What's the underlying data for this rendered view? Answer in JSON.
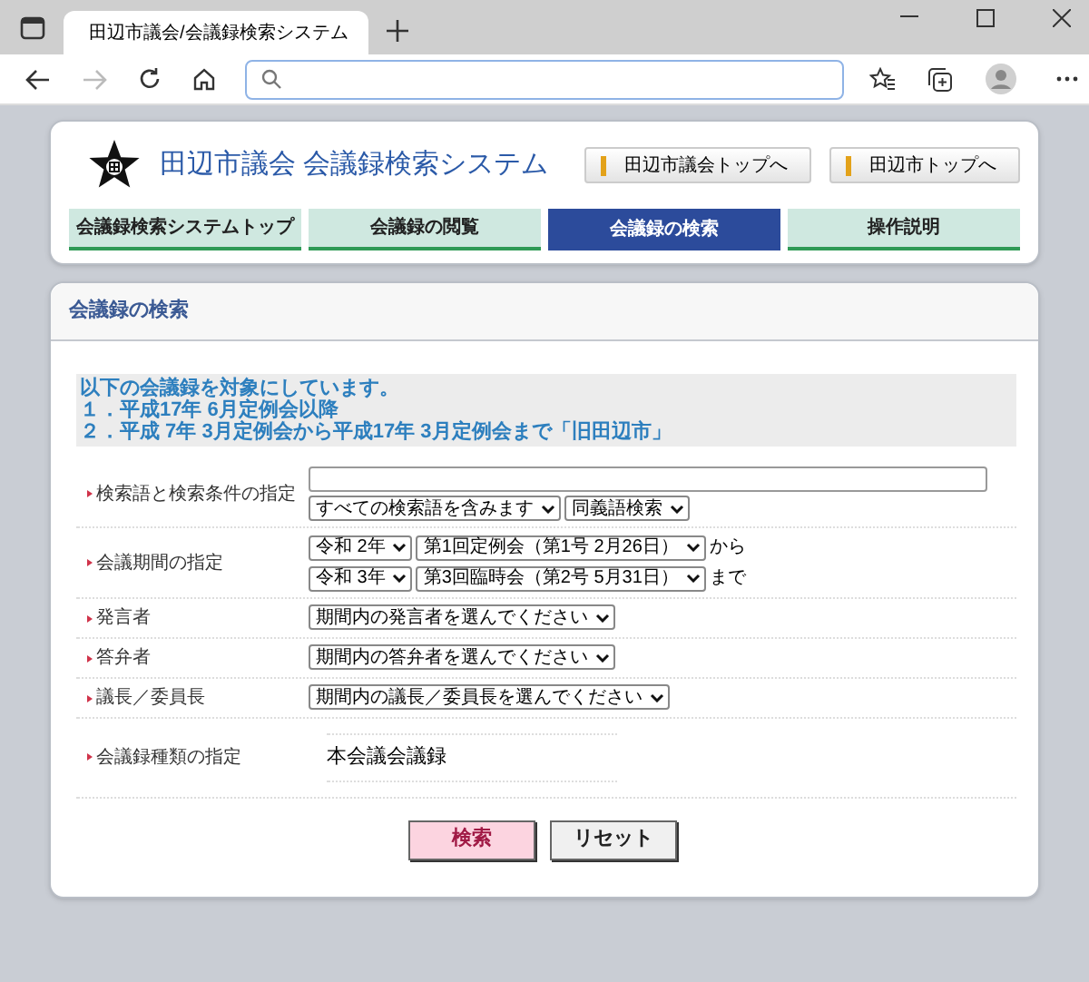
{
  "browser": {
    "tab_title": "田辺市議会/会議録検索システム"
  },
  "header": {
    "title": "田辺市議会 会議録検索システム",
    "links": [
      "田辺市議会トップへ",
      "田辺市トップへ"
    ],
    "nav": [
      {
        "label": "会議録検索システムトップ",
        "selected": false
      },
      {
        "label": "会議録の閲覧",
        "selected": false
      },
      {
        "label": "会議録の検索",
        "selected": true
      },
      {
        "label": "操作説明",
        "selected": false
      }
    ]
  },
  "panel": {
    "title": "会議録の検索",
    "notice": [
      "以下の会議録を対象にしています。",
      "１．平成17年 6月定例会以降",
      "２．平成 7年 3月定例会から平成17年 3月定例会まで「旧田辺市」"
    ],
    "rows": [
      {
        "kind": "keyword",
        "label": "検索語と検索条件の指定",
        "lines": [
          {
            "selects": [
              "すべての検索語を含みます",
              "同義語検索"
            ]
          }
        ]
      },
      {
        "kind": "period",
        "label": "会議期間の指定",
        "lines": [
          {
            "selects": [
              "令和 2年",
              "第1回定例会（第1号 2月26日）"
            ],
            "suffix": "から"
          },
          {
            "selects": [
              "令和 3年",
              "第3回臨時会（第2号 5月31日）"
            ],
            "suffix": "まで"
          }
        ]
      },
      {
        "kind": "select",
        "label": "発言者",
        "lines": [
          {
            "selects": [
              "期間内の発言者を選んでください"
            ]
          }
        ]
      },
      {
        "kind": "select",
        "label": "答弁者",
        "lines": [
          {
            "selects": [
              "期間内の答弁者を選んでください"
            ]
          }
        ]
      },
      {
        "kind": "select",
        "label": "議長／委員長",
        "lines": [
          {
            "selects": [
              "期間内の議長／委員長を選んでください"
            ]
          }
        ]
      },
      {
        "kind": "static",
        "label": "会議録種類の指定",
        "text": "本会議会議録"
      }
    ],
    "buttons": [
      {
        "label": "検索",
        "kind": "primary"
      },
      {
        "label": "リセット",
        "kind": "secondary"
      }
    ]
  }
}
